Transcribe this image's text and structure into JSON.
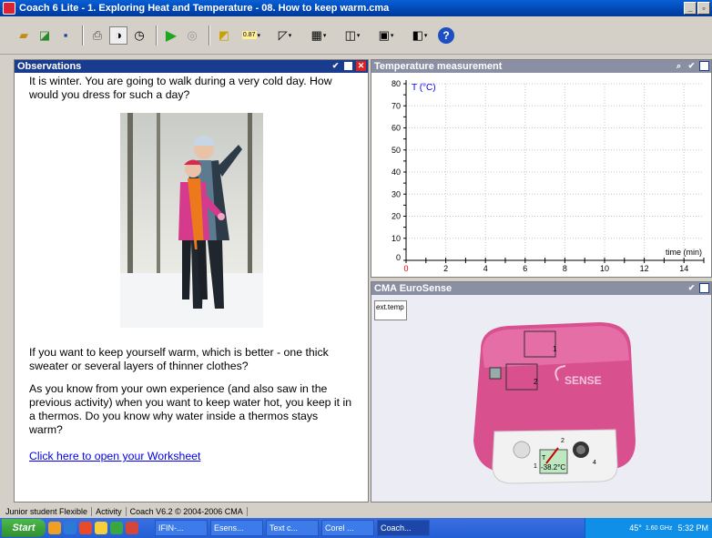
{
  "window": {
    "title": "Coach 6 Lite - 1. Exploring Heat and Temperature - 08. How to keep warm.cma",
    "minimize": "_",
    "restore": " "
  },
  "toolbar": {
    "icons": [
      "open-folder-icon",
      "open-icon",
      "save-icon",
      "print-icon",
      "sensor-icon",
      "stopwatch-icon",
      "start-icon",
      "stop-icon",
      "chart-icon",
      "meter-icon",
      "graph-icon",
      "table-icon",
      "text-icon",
      "picture-icon",
      "abc-icon",
      "help-icon"
    ],
    "value_icon_label": "0.87",
    "help_label": "?"
  },
  "observations": {
    "title": "Observations",
    "p1": "It is winter. You are going to walk during a very cold day. How would you dress for such a day?",
    "p2": "If you want to keep yourself warm, which is better - one thick sweater or several layers of thinner clothes?",
    "p3": "As you know from your own experience (and also saw in the previous activity) when you want to keep water hot, you keep it in a thermos.  Do you know why water inside a thermos stays warm?",
    "link": "Click here to open your Worksheet"
  },
  "temperature": {
    "title": "Temperature measurement"
  },
  "chart_data": {
    "type": "line",
    "ylabel": "T (°C)",
    "xlabel": "time (min)",
    "xlim": [
      0,
      15
    ],
    "ylim": [
      0,
      80
    ],
    "x_ticks": [
      "0",
      "2",
      "4",
      "6",
      "8",
      "10",
      "12",
      "14"
    ],
    "y_ticks": [
      "0",
      "10",
      "20",
      "30",
      "40",
      "50",
      "60",
      "70",
      "80"
    ],
    "grid": true,
    "series": []
  },
  "eurosense": {
    "title": "CMA EuroSense",
    "tag": "ext.temp",
    "brand": "SENSE",
    "port1": "1",
    "port2": "2",
    "port_b1": "1",
    "port_b2": "2",
    "port_b4": "4",
    "reading_label": "T",
    "reading_value": "-38.2°C"
  },
  "statusbar": {
    "user": "Junior student Flexible",
    "mode": "Activity",
    "version": "Coach V6.2 © 2004-2006 CMA"
  },
  "taskbar": {
    "start": "Start",
    "tasks": [
      "IFIN-...",
      "Esens...",
      "Text c...",
      "Corel ...",
      "Coach..."
    ],
    "tray_weather": "45°",
    "tray_freq": "1.60 GHz",
    "clock": "5:32 PM"
  },
  "colors": {
    "panel_header_active": "#1a3c8f",
    "panel_header_inactive": "#8a8fa3",
    "device_pink": "#d9508f",
    "axis_blue": "#0000ff",
    "origin_red": "#e00000"
  }
}
